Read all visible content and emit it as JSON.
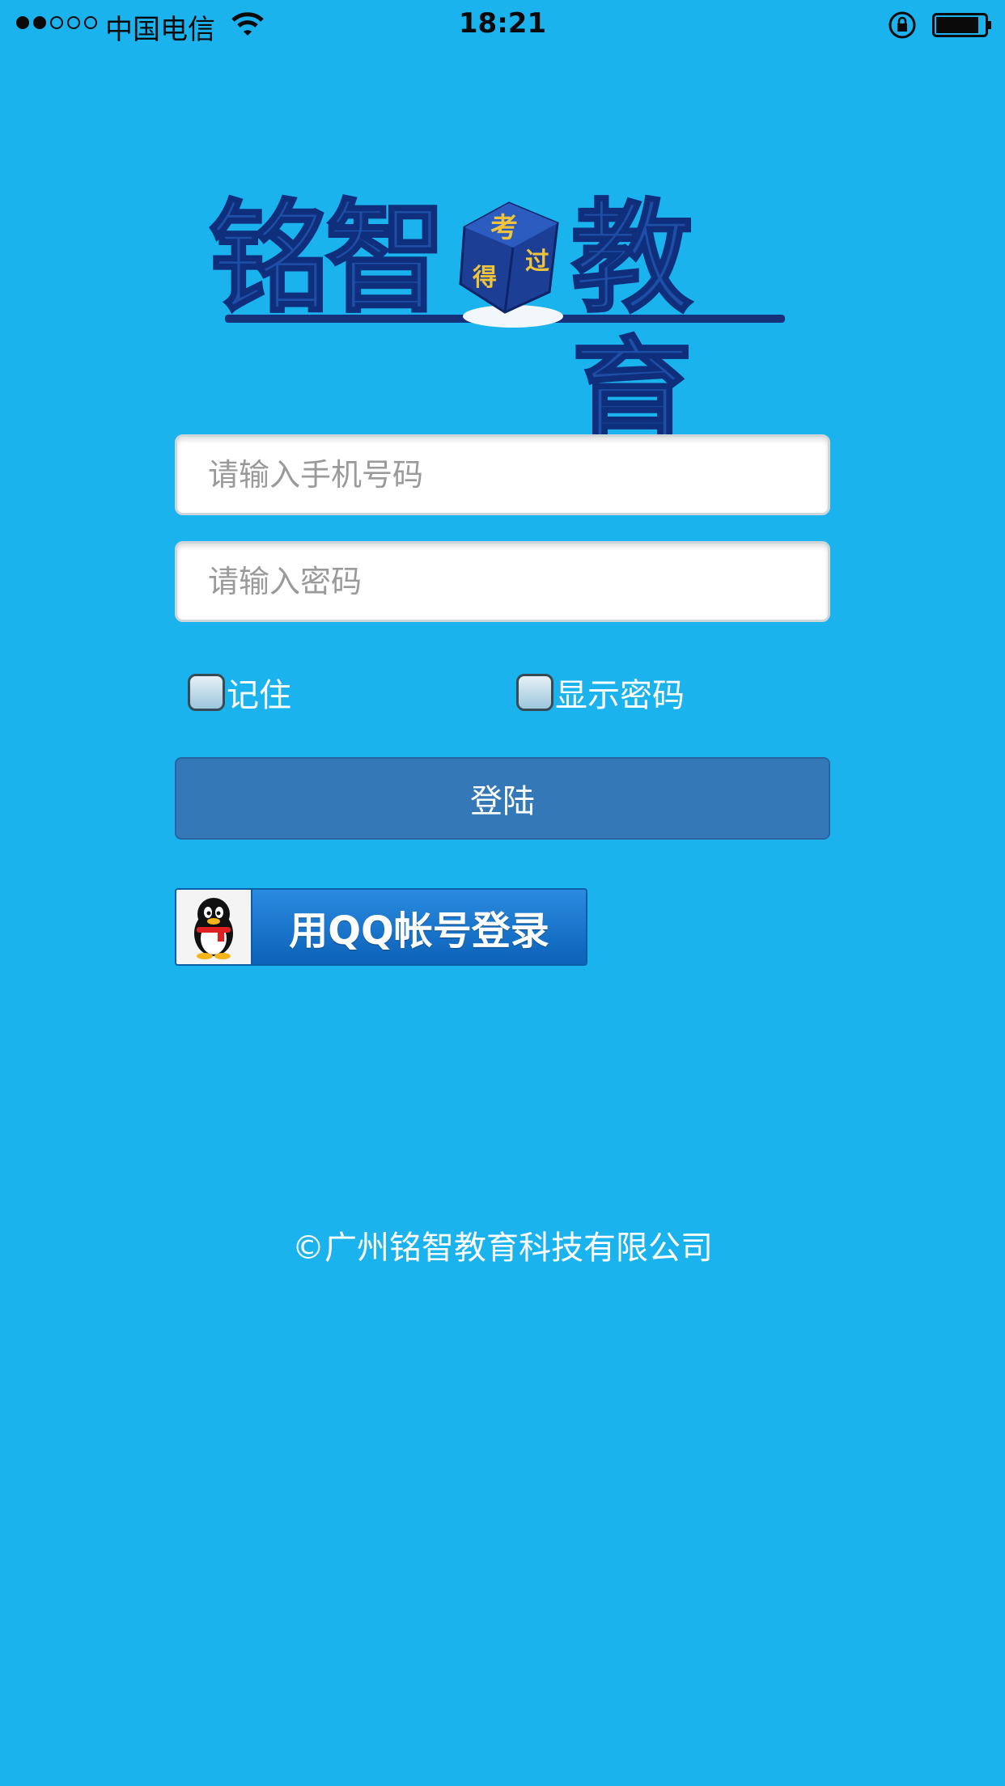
{
  "status_bar": {
    "carrier": "中国电信",
    "time": "18:21",
    "signal_bars_filled": 2,
    "signal_bars_total": 5
  },
  "logo": {
    "text_left": "铭智",
    "text_right": "教育",
    "cube_chars": [
      "考",
      "过",
      "得"
    ]
  },
  "form": {
    "phone_placeholder": "请输入手机号码",
    "phone_value": "",
    "password_placeholder": "请输入密码",
    "password_value": "",
    "remember_label": "记住",
    "remember_checked": false,
    "show_password_label": "显示密码",
    "show_password_checked": false,
    "login_label": "登陆"
  },
  "qq_login": {
    "label": "用QQ帐号登录"
  },
  "footer": {
    "copyright": "©广州铭智教育科技有限公司"
  },
  "colors": {
    "background": "#1ab3ee",
    "login_button": "#3478b8",
    "logo_blue": "#1e4fa6",
    "qq_blue": "#0c62b8"
  }
}
